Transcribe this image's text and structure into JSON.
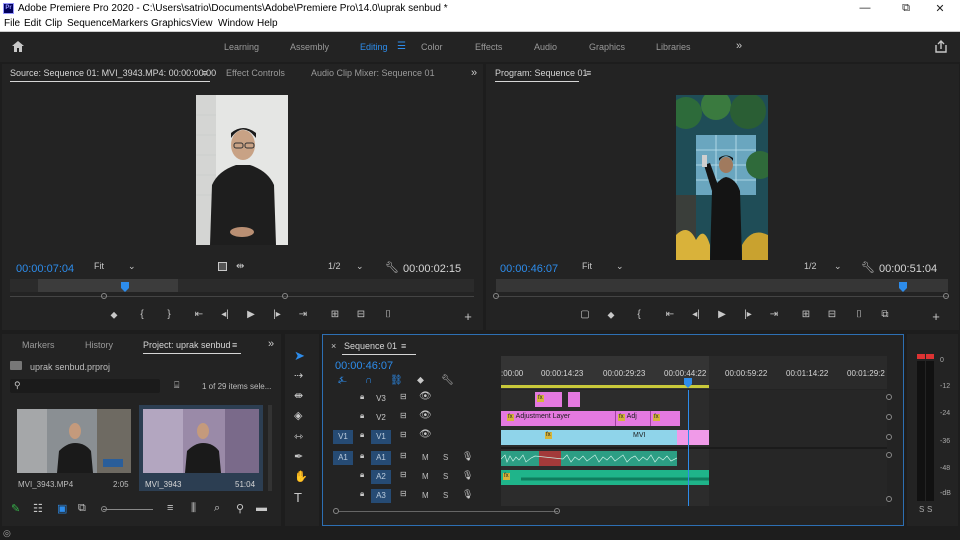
{
  "window": {
    "title": "Adobe Premiere Pro 2020 - C:\\Users\\satrio\\Documents\\Adobe\\Premiere Pro\\14.0\\uprak senbud *",
    "logo_text": "Pr",
    "minimize_glyph": "—",
    "maximize_glyph": "⧉",
    "close_glyph": "✕"
  },
  "menu": [
    "File",
    "Edit",
    "Clip",
    "Sequence",
    "Markers",
    "Graphics",
    "View",
    "Window",
    "Help"
  ],
  "workspaces": {
    "items": [
      "Learning",
      "Assembly",
      "Editing",
      "Color",
      "Effects",
      "Audio",
      "Graphics",
      "Libraries"
    ],
    "active": "Editing",
    "more": "»"
  },
  "source_panel": {
    "tabs": [
      "Source: Sequence 01: MVI_3943.MP4: 00:00:00:00",
      "Effect Controls",
      "Audio Clip Mixer: Sequence 01"
    ],
    "more": "»",
    "current_time": "00:00:07:04",
    "zoom": "Fit",
    "resolution": "1/2",
    "duration": "00:00:02:15"
  },
  "program_panel": {
    "tab": "Program: Sequence 01",
    "current_time": "00:00:46:07",
    "zoom": "Fit",
    "resolution": "1/2",
    "duration": "00:00:51:04"
  },
  "project_panel": {
    "tabs": [
      "Markers",
      "History",
      "Project: uprak senbud"
    ],
    "more": "»",
    "file": "uprak senbud.prproj",
    "search_placeholder": "",
    "item_count": "1 of 29 items sele...",
    "items": [
      {
        "name": "MVI_3943.MP4",
        "duration": "2:05"
      },
      {
        "name": "MVI_3943",
        "duration": "51:04"
      }
    ]
  },
  "timeline": {
    "tab": "Sequence 01",
    "close": "×",
    "current_time": "00:00:46:07",
    "ruler": [
      ":00:00",
      "00:00:14:23",
      "00:00:29:23",
      "00:00:44:22",
      "00:00:59:22",
      "00:01:14:22",
      "00:01:29:2"
    ],
    "tracks": {
      "video": [
        "V3",
        "V2",
        "V1"
      ],
      "audio": [
        "A1",
        "A2",
        "A3"
      ],
      "source_v": "V1",
      "source_a": "A1",
      "mute": "M",
      "solo": "S"
    },
    "clips": {
      "adjustment_1": "Adjustment Layer",
      "adjustment_2": "Adj",
      "fx": "fx",
      "mvi": "MVI"
    }
  },
  "audio_meter": {
    "scale": [
      "0",
      "-12",
      "-24",
      "-36",
      "-48",
      "-dB"
    ],
    "solo": [
      "S",
      "S"
    ]
  },
  "colors": {
    "accent": "#2d8ceb",
    "adjustment_clip": "#e479e0",
    "video_clip": "#8fd4ea",
    "audio_clip": "#2c9e84",
    "audio_clip_a2": "#1fb48a",
    "playhead": "#2d8ceb"
  }
}
